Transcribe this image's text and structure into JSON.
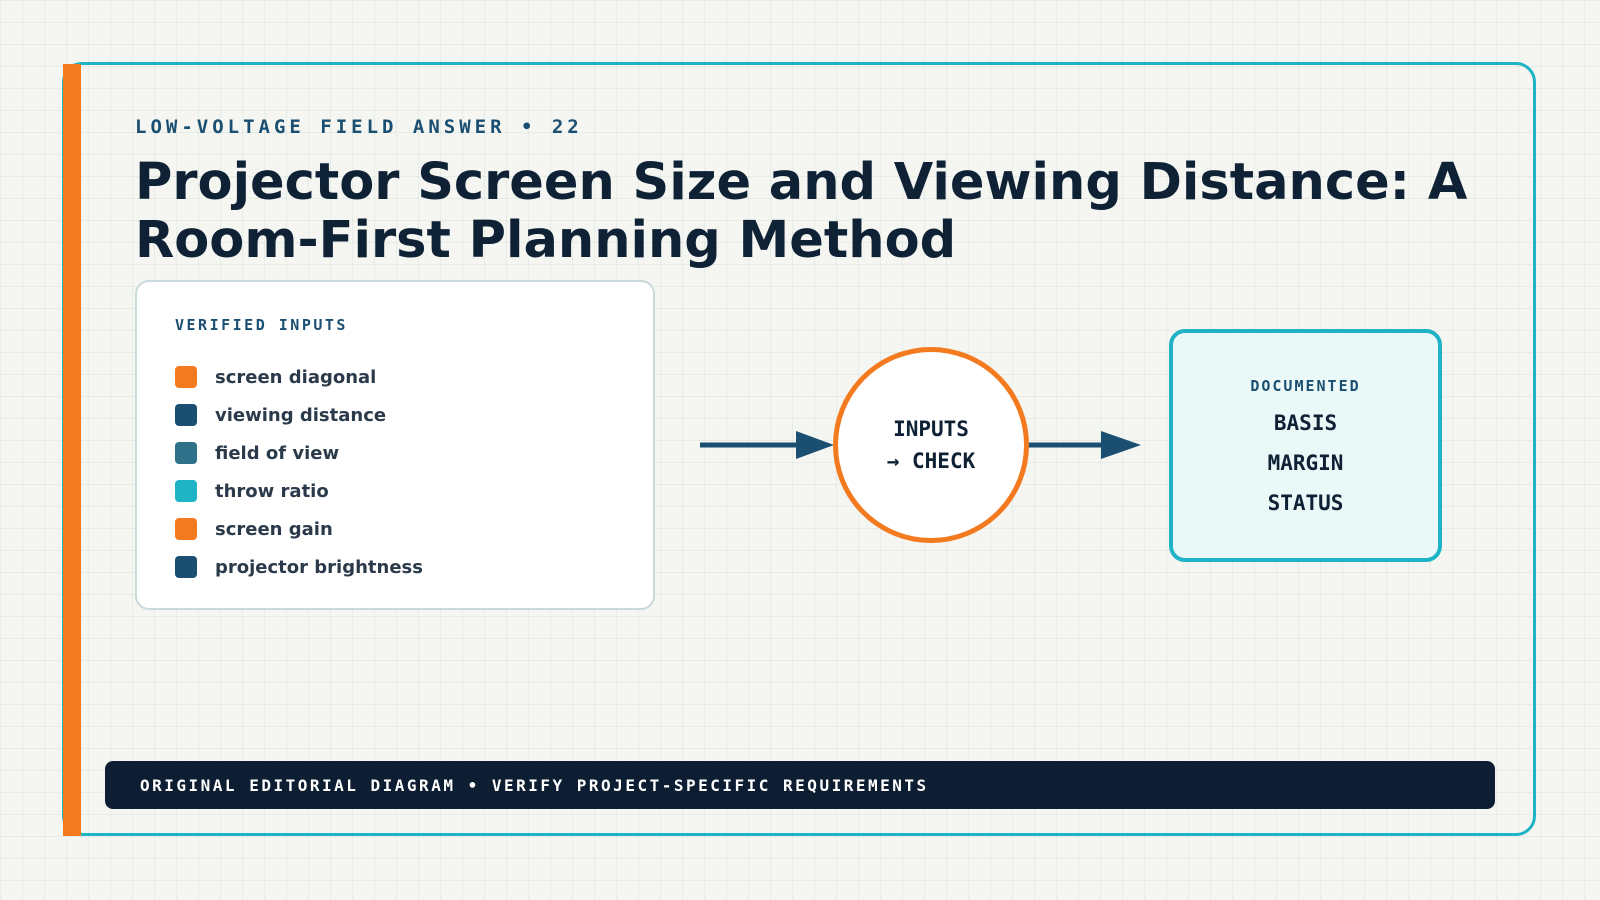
{
  "header": {
    "kicker": "LOW-VOLTAGE FIELD ANSWER • 22",
    "title": "Projector Screen Size and Viewing Distance: A Room-First Planning Method"
  },
  "inputs_card": {
    "label": "VERIFIED INPUTS",
    "items": [
      {
        "label": "screen diagonal",
        "color": "#f47a1f"
      },
      {
        "label": "viewing distance",
        "color": "#1b4f72"
      },
      {
        "label": "field of view",
        "color": "#2e7189"
      },
      {
        "label": "throw ratio",
        "color": "#1fb3c6"
      },
      {
        "label": "screen gain",
        "color": "#f47a1f"
      },
      {
        "label": "projector brightness",
        "color": "#1b4f72"
      }
    ]
  },
  "check_node": {
    "line1": "INPUTS",
    "line2": "→ CHECK"
  },
  "output_card": {
    "label": "DOCUMENTED",
    "items": [
      "BASIS",
      "MARGIN",
      "STATUS"
    ]
  },
  "footer": {
    "text": "ORIGINAL EDITORIAL DIAGRAM • VERIFY PROJECT-SPECIFIC REQUIREMENTS"
  },
  "colors": {
    "accent_orange": "#f47a1f",
    "accent_teal": "#1fb3c6",
    "navy": "#0e2135",
    "arrow": "#1b4f72"
  }
}
